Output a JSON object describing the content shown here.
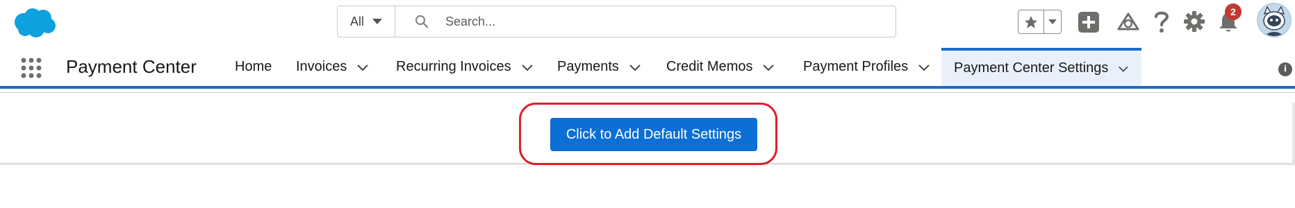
{
  "header": {
    "search": {
      "scope": "All",
      "placeholder": "Search...",
      "value": ""
    },
    "notifications_count": "2",
    "icons": [
      "salesforce-cloud-logo",
      "star-icon",
      "chevron-down-icon",
      "plus-icon",
      "trailhead-icon",
      "help-icon",
      "gear-icon",
      "bell-icon",
      "avatar"
    ]
  },
  "nav": {
    "app_name": "Payment Center",
    "tabs": [
      {
        "label": "Home"
      },
      {
        "label": "Invoices"
      },
      {
        "label": "Recurring Invoices"
      },
      {
        "label": "Payments"
      },
      {
        "label": "Credit Memos"
      },
      {
        "label": "Payment Profiles"
      },
      {
        "label": "Payment Center Settings",
        "active": true
      }
    ]
  },
  "main": {
    "button_label": "Click to Add Default Settings"
  },
  "colors": {
    "brand_blue": "#0b6fd6",
    "nav_accent": "#1b6ac9",
    "highlight_red": "#e01e2b",
    "badge_red": "#c23934"
  }
}
